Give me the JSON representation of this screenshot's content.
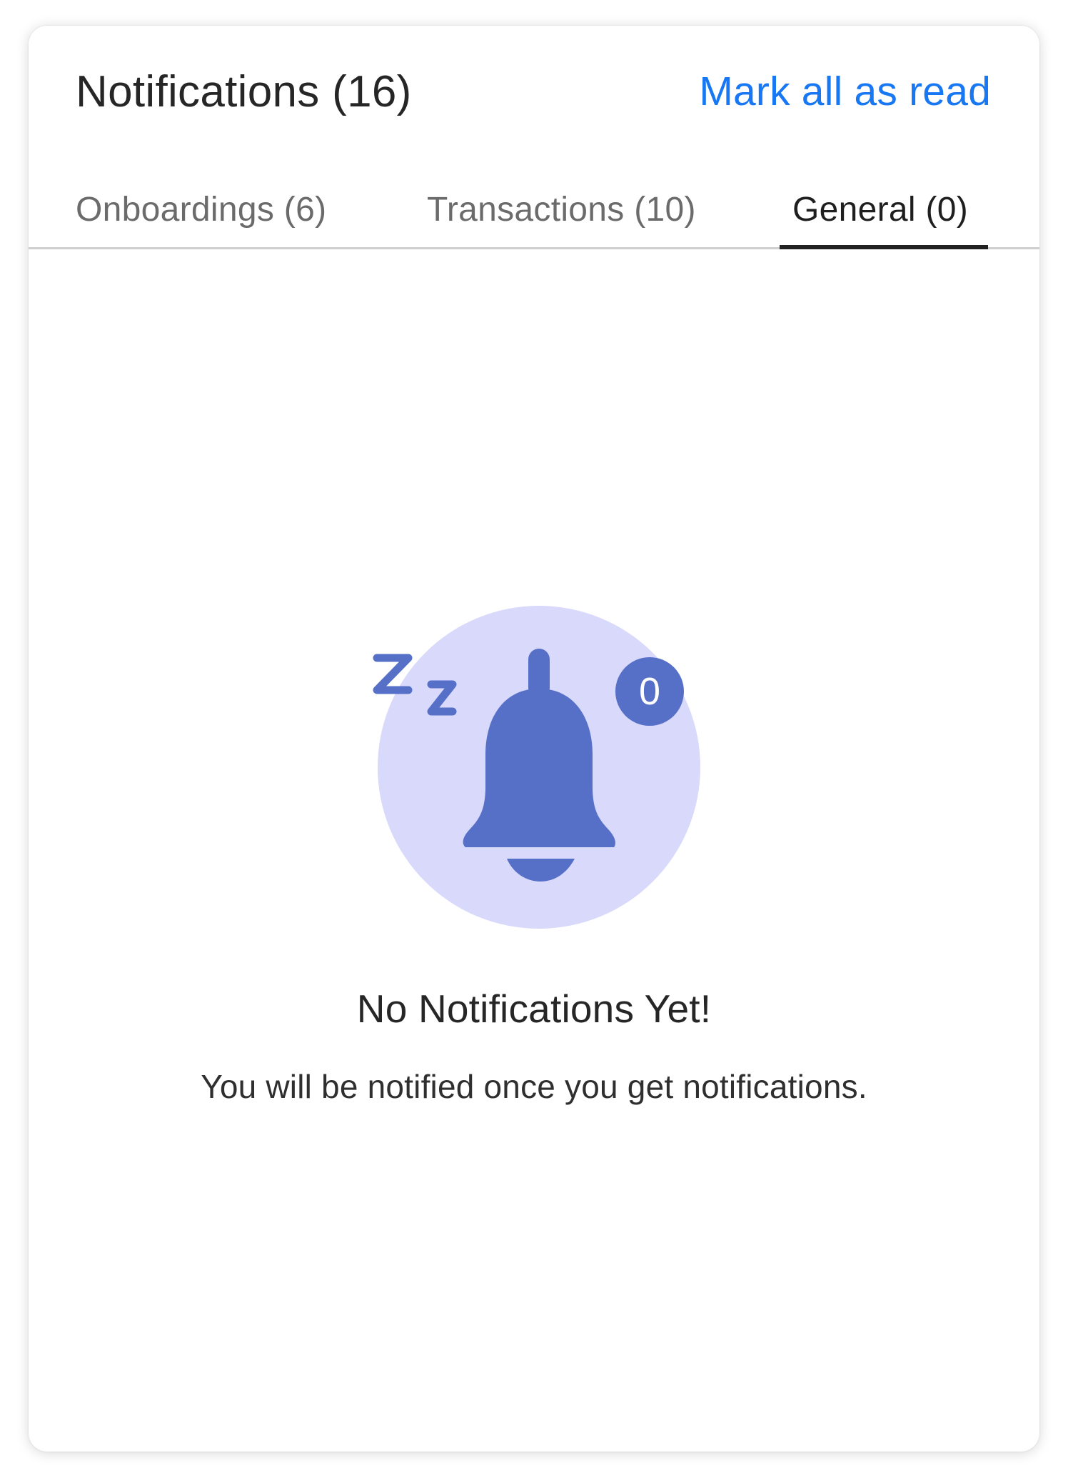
{
  "header": {
    "title": "Notifications (16)",
    "mark_all_label": "Mark all as read"
  },
  "tabs": [
    {
      "label": "Onboardings (6)",
      "active": false
    },
    {
      "label": "Transactions (10)",
      "active": false
    },
    {
      "label": "General (0)",
      "active": true
    }
  ],
  "empty_state": {
    "icon": "sleeping-bell-icon",
    "badge_count": "0",
    "snooze_text": "Zz",
    "title": "No Notifications Yet!",
    "subtitle": "You will be notified once you get notifications."
  },
  "colors": {
    "accent": "#1877f2",
    "illustration_bg": "#d9d9fc",
    "illustration_fg": "#5670c8",
    "active_tab": "#222222"
  }
}
